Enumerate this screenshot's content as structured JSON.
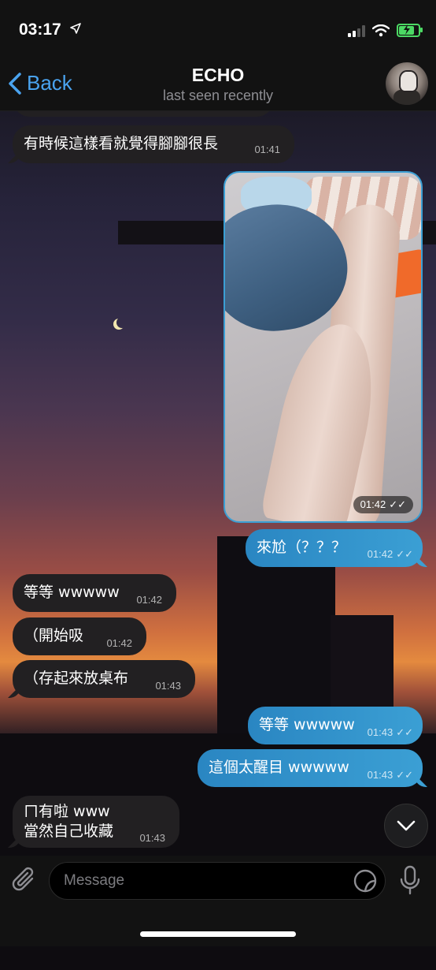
{
  "status_bar": {
    "time": "03:17",
    "location_icon": "location-arrow-icon",
    "battery_color": "#4cd964"
  },
  "header": {
    "back_label": "Back",
    "title": "ECHO",
    "subtitle": "last seen recently"
  },
  "messages": [
    {
      "dir": "in",
      "text": "有時候這樣看就覺得腳腳很長",
      "time": "01:41"
    },
    {
      "dir": "out",
      "type": "photo",
      "time": "01:42",
      "read": true
    },
    {
      "dir": "out",
      "text": "來尬（？？？",
      "time": "01:42",
      "read": true
    },
    {
      "dir": "in",
      "text": "等等 wwwww",
      "time": "01:42"
    },
    {
      "dir": "in",
      "text": "（開始吸",
      "time": "01:42"
    },
    {
      "dir": "in",
      "text": "（存起來放桌布",
      "time": "01:43"
    },
    {
      "dir": "out",
      "text": "等等 wwwww",
      "time": "01:43",
      "read": true
    },
    {
      "dir": "out",
      "text": "這個太醒目 wwwww",
      "time": "01:43",
      "read": true
    },
    {
      "dir": "in",
      "text_line1": "ㄇ有啦 www",
      "text_line2": "當然自己收藏",
      "time": "01:43"
    }
  ],
  "composer": {
    "placeholder": "Message"
  },
  "colors": {
    "accent": "#4aa3ef",
    "outgoing_bubble": "#3b9fd4",
    "incoming_bubble": "#222022"
  }
}
